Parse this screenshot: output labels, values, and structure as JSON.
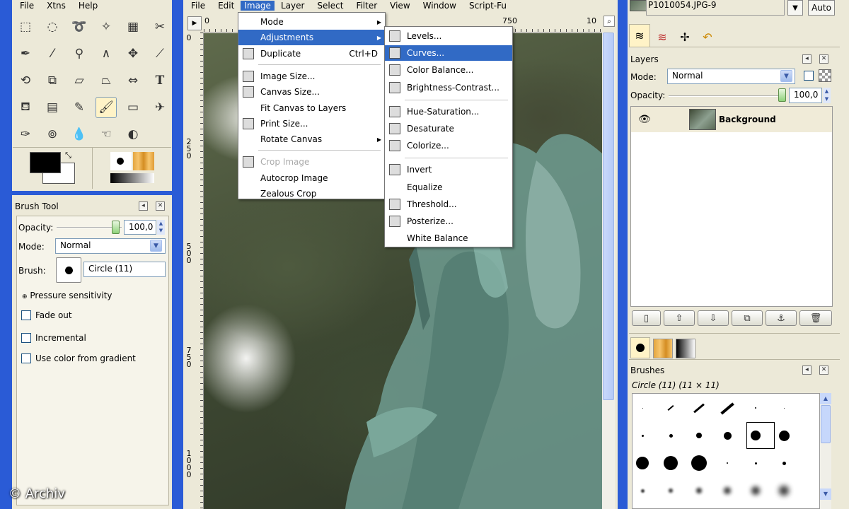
{
  "toolbox": {
    "menu": [
      "File",
      "Xtns",
      "Help"
    ],
    "tool_icons": [
      "rect-select-icon",
      "ellipse-select-icon",
      "lasso-icon",
      "fuzzy-select-icon",
      "color-select-icon",
      "scissors-icon",
      "paths-icon",
      "color-picker-icon",
      "zoom-icon",
      "measure-icon",
      "move-icon",
      "knife-icon",
      "rotate-icon",
      "scale-icon",
      "shear-icon",
      "perspective-icon",
      "flip-icon",
      "text-tool-icon",
      "bucket-fill-icon",
      "blend-icon",
      "pencil-icon",
      "paintbrush-icon",
      "eraser-icon",
      "airbrush-icon",
      "ink-icon",
      "clone-icon",
      "blur-icon",
      "smudge-icon",
      "dodge-burn-icon"
    ],
    "fg_color": "#000000",
    "bg_color": "#ffffff"
  },
  "tool_options": {
    "title": "Brush Tool",
    "opacity_label": "Opacity:",
    "opacity_value": "100,0",
    "mode_label": "Mode:",
    "mode_value": "Normal",
    "brush_label": "Brush:",
    "brush_value": "Circle (11)",
    "pressure_label": "Pressure sensitivity",
    "fade_label": "Fade out",
    "incremental_label": "Incremental",
    "gradient_label": "Use color from gradient"
  },
  "image_window": {
    "menu": [
      "File",
      "Edit",
      "Image",
      "Layer",
      "Select",
      "Filter",
      "View",
      "Window",
      "Script-Fu"
    ],
    "active_menu": "Image",
    "ruler_top": [
      "0",
      "750",
      "10"
    ],
    "ruler_left": [
      "0",
      "2\n5\n0",
      "5\n0\n0",
      "7\n5\n0",
      "1\n0\n0\n0"
    ]
  },
  "image_menu": {
    "items": [
      {
        "label": "Mode",
        "submenu": true
      },
      {
        "label": "Adjustments",
        "submenu": true,
        "highlighted": true
      },
      {
        "label": "Duplicate",
        "shortcut": "Ctrl+D",
        "icon": "duplicate-icon"
      },
      {
        "label": "Image Size...",
        "icon": "image-size-icon"
      },
      {
        "label": "Canvas Size...",
        "icon": "canvas-size-icon"
      },
      {
        "label": "Fit Canvas to Layers"
      },
      {
        "label": "Print Size...",
        "icon": "print-icon"
      },
      {
        "label": "Rotate Canvas",
        "submenu": true
      },
      {
        "label": "Crop Image",
        "disabled": true,
        "icon": "crop-icon"
      },
      {
        "label": "Autocrop Image"
      },
      {
        "label": "Zealous Crop"
      }
    ]
  },
  "adjust_menu": {
    "items": [
      {
        "label": "Levels...",
        "icon": "levels-icon"
      },
      {
        "label": "Curves...",
        "icon": "curves-icon",
        "highlighted": true
      },
      {
        "label": "Color Balance...",
        "icon": "color-balance-icon"
      },
      {
        "label": "Brightness-Contrast...",
        "icon": "brightness-contrast-icon"
      },
      {
        "label": "Hue-Saturation...",
        "icon": "hue-saturation-icon"
      },
      {
        "label": "Desaturate",
        "icon": "desaturate-icon"
      },
      {
        "label": "Colorize...",
        "icon": "colorize-icon"
      },
      {
        "label": "Invert",
        "icon": "invert-icon"
      },
      {
        "label": "Equalize"
      },
      {
        "label": "Threshold...",
        "icon": "threshold-icon"
      },
      {
        "label": "Posterize...",
        "icon": "posterize-icon"
      },
      {
        "label": "White Balance"
      }
    ]
  },
  "dock": {
    "image_selector": "P1010054.JPG-9",
    "auto_label": "Auto",
    "layers_title": "Layers",
    "mode_label": "Mode:",
    "mode_value": "Normal",
    "opacity_label": "Opacity:",
    "opacity_value": "100,0",
    "layer_name": "Background",
    "brushes_title": "Brushes",
    "brush_info": "Circle (11) (11 × 11)"
  },
  "watermark": "© Archiv"
}
